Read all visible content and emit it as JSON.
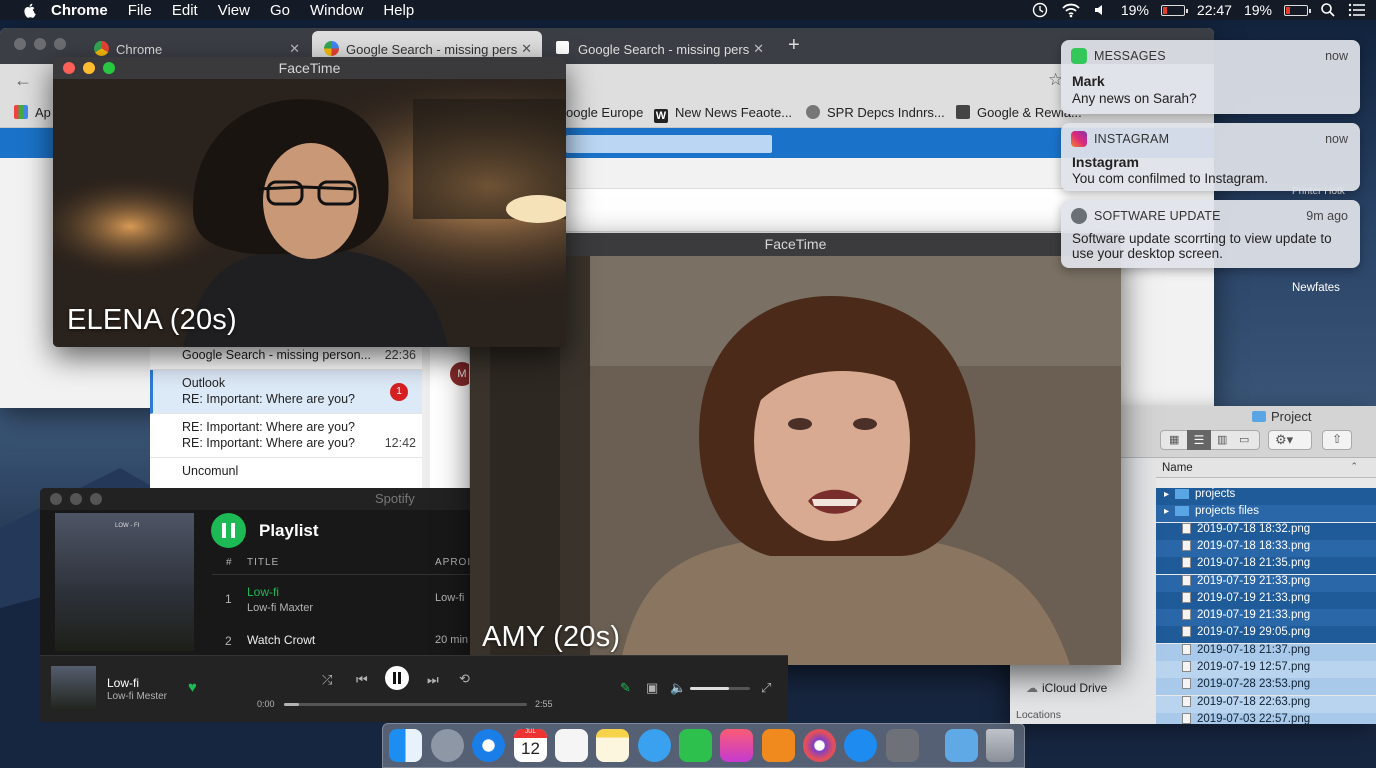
{
  "menubar": {
    "app_name": "Chrome",
    "items": [
      "File",
      "Edit",
      "View",
      "Go",
      "Window",
      "Help"
    ],
    "battery_percent_1": "19%",
    "time": "22:47",
    "battery_percent_2": "19%"
  },
  "chrome": {
    "tabs": [
      {
        "title": "Chrome"
      },
      {
        "title": "Google Search - missing pers"
      },
      {
        "title": "Google Search - missing pers"
      }
    ],
    "new_tab": "+",
    "bookmarks": [
      {
        "label": "Ap"
      },
      {
        "label": "oogle Europe"
      },
      {
        "label": "New News Feaote..."
      },
      {
        "label": "SPR Depcs Indnrs..."
      },
      {
        "label": "Google & Rewia..."
      }
    ]
  },
  "mail": {
    "rows": [
      {
        "line1": "Google Search - missing person...",
        "time": "22:36"
      },
      {
        "line1": "Outlook",
        "line2": "RE: Important: Where are you?",
        "badge": "1"
      },
      {
        "line1": "RE: Important: Where are you?",
        "line2": "RE: Important: Where are you?",
        "time": "12:42"
      },
      {
        "line1": "Uncomunl"
      }
    ],
    "avatar_letter": "M"
  },
  "facetime": {
    "window_title_1": "FaceTime",
    "label_1": "ELENA (20s)",
    "window_title_2": "FaceTime",
    "label_2": "AMY (20s)"
  },
  "spotify": {
    "window_title": "Spotify",
    "album_text": "LOW - FI",
    "playlist_title": "Playlist",
    "col_num": "#",
    "col_title": "TITLE",
    "col_album": "APROI",
    "tracks": [
      {
        "num": "1",
        "title": "Low-fi",
        "artist": "Low-fi Maxter",
        "album": "Low-fi"
      },
      {
        "num": "2",
        "title": "Watch Crowt",
        "artist": "",
        "album": "20 min"
      }
    ],
    "now_playing_title": "Low-fi",
    "now_playing_artist": "Low-fi Mester",
    "time_elapsed": "0:00",
    "time_total": "2:55",
    "progress": 0.06,
    "volume": 0.65
  },
  "notifications": [
    {
      "app": "MESSAGES",
      "when": "now",
      "title": "Mark",
      "body": "Any news on Sarah?",
      "color": "#34c759"
    },
    {
      "app": "INSTAGRAM",
      "when": "now",
      "title": "Instagram",
      "body": "You com confilmed to Instagram.",
      "color": "#d62976"
    },
    {
      "app": "SOFTWARE UPDATE",
      "when": "9m ago",
      "title": "",
      "body": "Software update scorrting to view update to use your desktop screen.",
      "color": "#6b6f76"
    }
  ],
  "desktop": {
    "label_newfates": "Newfates",
    "label_partial": "Printer Hotk"
  },
  "finder": {
    "title": "Project",
    "column_name": "Name",
    "files": [
      {
        "name": "projects",
        "kind": "folder",
        "selected": true
      },
      {
        "name": "projects files",
        "kind": "folder",
        "selected": true
      },
      {
        "name": "2019-07-18 18:32.png",
        "kind": "file",
        "selected": true
      },
      {
        "name": "2019-07-18 18:33.png",
        "kind": "file",
        "selected": true
      },
      {
        "name": "2019-07-18 21:35.png",
        "kind": "file",
        "selected": true
      },
      {
        "name": "2019-07-19 21:33.png",
        "kind": "file",
        "selected": true
      },
      {
        "name": "2019-07-19 21:33.png",
        "kind": "file",
        "selected": true
      },
      {
        "name": "2019-07-19 21:33.png",
        "kind": "file",
        "selected": true
      },
      {
        "name": "2019-07-19 29:05.png",
        "kind": "file",
        "selected": true
      },
      {
        "name": "2019-07-18 21:37.png",
        "kind": "file",
        "selected": false
      },
      {
        "name": "2019-07-19 12:57.png",
        "kind": "file",
        "selected": false
      },
      {
        "name": "2019-07-28 23:53.png",
        "kind": "file",
        "selected": false
      },
      {
        "name": "2019-07-18 22:63.png",
        "kind": "file",
        "selected": false
      },
      {
        "name": "2019-07-03 22:57.png",
        "kind": "file",
        "selected": false
      }
    ],
    "sidebar_icloud": "iCloud Drive",
    "sidebar_locations": "Locations"
  },
  "dock": {
    "calendar_day": "12",
    "calendar_month": "JUL"
  }
}
